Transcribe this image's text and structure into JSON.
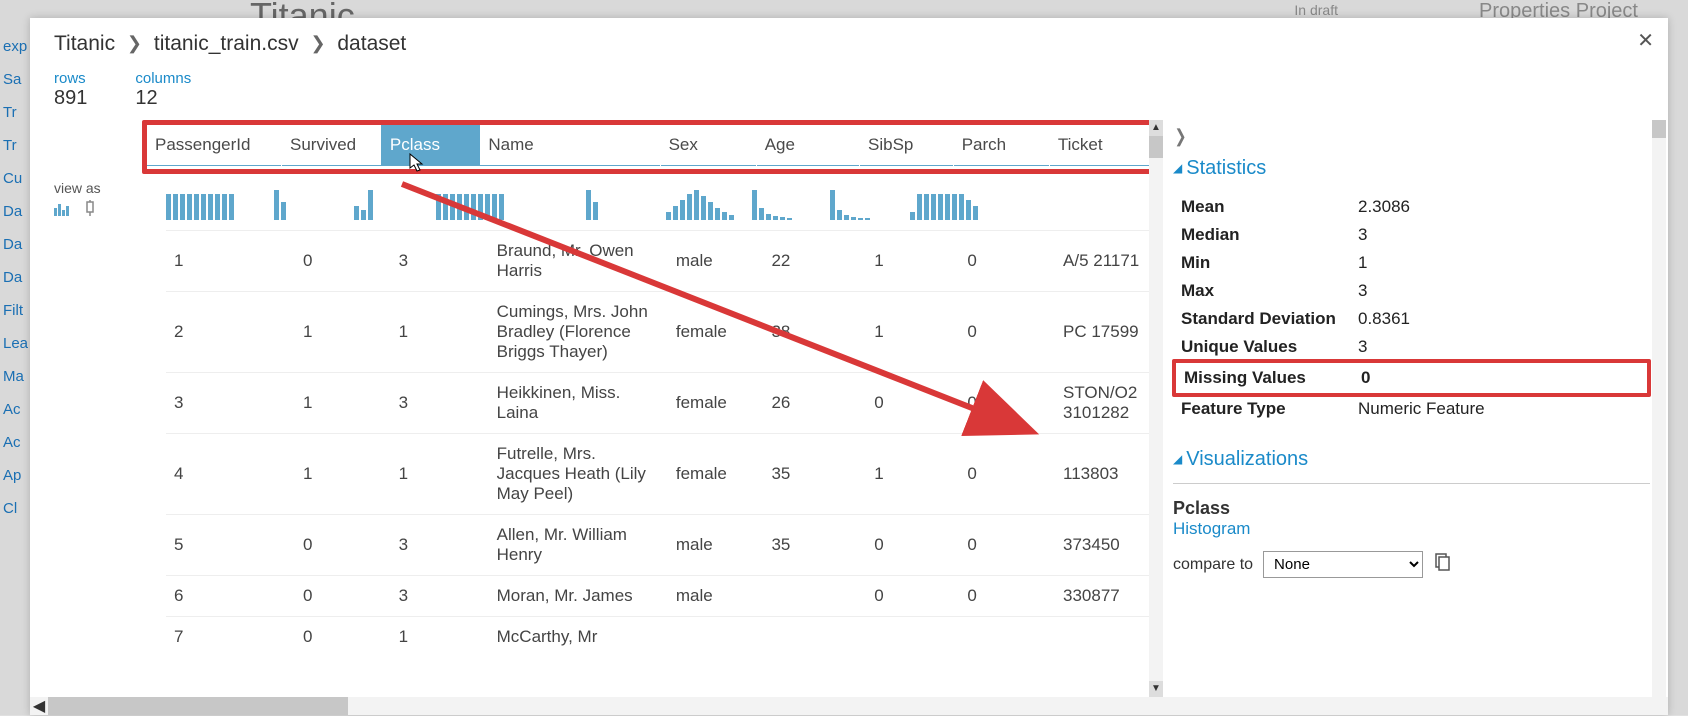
{
  "background": {
    "title_partial": "Titanic",
    "status": "In draft",
    "tabs": "Properties  Project",
    "left_items": [
      "exp",
      "Sa",
      "Tr",
      "Tr",
      "Cu",
      "Da",
      "Da",
      "Da",
      "Filt",
      "Lea",
      "Ma",
      "Ac",
      "Ac",
      "Ap",
      "Cl"
    ]
  },
  "breadcrumb": {
    "root": "Titanic",
    "file": "titanic_train.csv",
    "leaf": "dataset"
  },
  "summary": {
    "rows_label": "rows",
    "rows_value": "891",
    "cols_label": "columns",
    "cols_value": "12"
  },
  "view_as_label": "view as",
  "headers": [
    "PassengerId",
    "Survived",
    "Pclass",
    "Name",
    "Sex",
    "Age",
    "SibSp",
    "Parch",
    "Ticket"
  ],
  "selected_header_index": 2,
  "rows": [
    {
      "pid": "1",
      "surv": "0",
      "pcl": "3",
      "name": "Braund, Mr. Owen Harris",
      "sex": "male",
      "age": "22",
      "sib": "1",
      "par": "0",
      "tkt": "A/5 21171"
    },
    {
      "pid": "2",
      "surv": "1",
      "pcl": "1",
      "name": "Cumings, Mrs. John Bradley (Florence Briggs Thayer)",
      "sex": "female",
      "age": "38",
      "sib": "1",
      "par": "0",
      "tkt": "PC 17599"
    },
    {
      "pid": "3",
      "surv": "1",
      "pcl": "3",
      "name": "Heikkinen, Miss. Laina",
      "sex": "female",
      "age": "26",
      "sib": "0",
      "par": "0",
      "tkt": "STON/O2 3101282"
    },
    {
      "pid": "4",
      "surv": "1",
      "pcl": "1",
      "name": "Futrelle, Mrs. Jacques Heath (Lily May Peel)",
      "sex": "female",
      "age": "35",
      "sib": "1",
      "par": "0",
      "tkt": "113803"
    },
    {
      "pid": "5",
      "surv": "0",
      "pcl": "3",
      "name": "Allen, Mr. William Henry",
      "sex": "male",
      "age": "35",
      "sib": "0",
      "par": "0",
      "tkt": "373450"
    },
    {
      "pid": "6",
      "surv": "0",
      "pcl": "3",
      "name": "Moran, Mr. James",
      "sex": "male",
      "age": "",
      "sib": "0",
      "par": "0",
      "tkt": "330877"
    },
    {
      "pid": "7",
      "surv": "0",
      "pcl": "1",
      "name": "McCarthy, Mr",
      "sex": "",
      "age": "",
      "sib": "",
      "par": "",
      "tkt": ""
    }
  ],
  "sparks": {
    "PassengerId": [
      26,
      26,
      26,
      26,
      26,
      26,
      26,
      26,
      26,
      26
    ],
    "Survived": [
      30,
      18
    ],
    "Pclass": [
      14,
      10,
      30
    ],
    "Name": [
      26,
      26,
      26,
      26,
      26,
      26,
      26,
      26,
      26,
      26
    ],
    "Sex": [
      30,
      18
    ],
    "Age": [
      8,
      14,
      20,
      26,
      30,
      24,
      18,
      12,
      8,
      5
    ],
    "SibSp": [
      30,
      12,
      6,
      4,
      3,
      2
    ],
    "Parch": [
      30,
      10,
      5,
      3,
      2,
      2
    ],
    "Ticket": [
      8,
      26,
      26,
      26,
      26,
      26,
      26,
      26,
      20,
      14
    ]
  },
  "stats": {
    "title": "Statistics",
    "items": [
      {
        "k": "Mean",
        "v": "2.3086"
      },
      {
        "k": "Median",
        "v": "3"
      },
      {
        "k": "Min",
        "v": "1"
      },
      {
        "k": "Max",
        "v": "3"
      },
      {
        "k": "Standard Deviation",
        "v": "0.8361"
      },
      {
        "k": "Unique Values",
        "v": "3"
      },
      {
        "k": "Missing Values",
        "v": "0",
        "highlighted": true
      },
      {
        "k": "Feature Type",
        "v": "Numeric Feature"
      }
    ]
  },
  "viz": {
    "title": "Visualizations",
    "feature": "Pclass",
    "type": "Histogram",
    "compare_label": "compare to",
    "compare_selected": "None"
  }
}
